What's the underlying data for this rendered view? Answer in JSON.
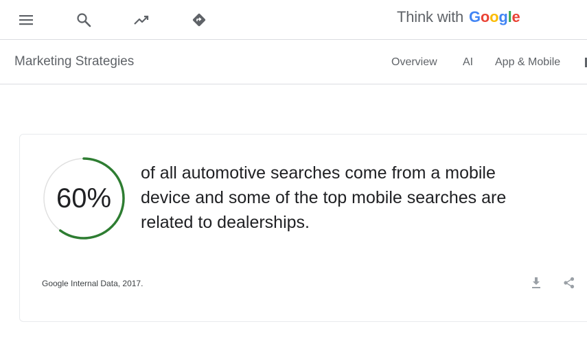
{
  "header": {
    "icons": [
      "menu-icon",
      "search-icon",
      "trending-icon",
      "directions-icon"
    ],
    "brand_prefix": "Think with ",
    "brand_google": "Google",
    "brand_colors": [
      "#4285F4",
      "#EA4335",
      "#FBBC05",
      "#4285F4",
      "#34A853",
      "#EA4335"
    ]
  },
  "subnav": {
    "section_title": "Marketing Strategies",
    "links": [
      "Overview",
      "AI",
      "App & Mobile"
    ]
  },
  "stat_card": {
    "percent_label": "60%",
    "progress_value": 0.6,
    "ring_color": "#2e7d32",
    "ring_track_color": "#e0e0e0",
    "statement": "of all automotive searches come from a mobile device and some of the top mobile searches are related to dealerships.",
    "source": "Google Internal Data, 2017.",
    "action_icons": [
      "download-icon",
      "share-icon"
    ]
  }
}
